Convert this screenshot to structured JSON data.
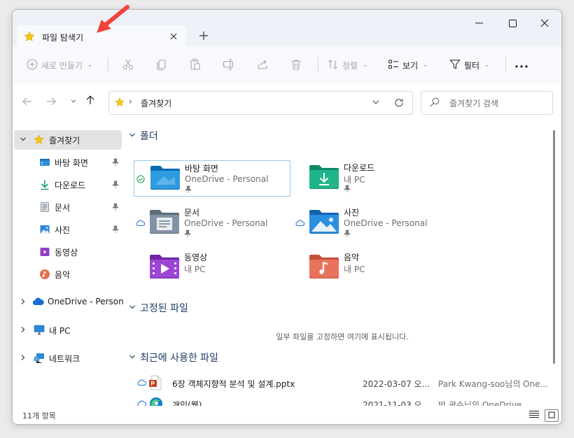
{
  "window": {
    "tab_title": "파일 탐색기"
  },
  "toolbar": {
    "new_label": "새로 만들기",
    "sort_label": "정렬",
    "view_label": "보기",
    "filter_label": "필터"
  },
  "address": {
    "location": "즐겨찾기",
    "separator": "›"
  },
  "search": {
    "placeholder": "즐겨찾기 검색"
  },
  "sidebar": {
    "favorites": "즐겨찾기",
    "items": [
      {
        "label": "바탕 화면"
      },
      {
        "label": "다운로드"
      },
      {
        "label": "문서"
      },
      {
        "label": "사진"
      },
      {
        "label": "동영상"
      },
      {
        "label": "음악"
      }
    ],
    "onedrive": "OneDrive - Persona",
    "thispc": "내 PC",
    "network": "네트워크"
  },
  "sections": {
    "folders": "폴더",
    "pinned": "고정된 파일",
    "recent": "최근에 사용한 파일",
    "pinned_empty": "일부 파일을 고정하면 여기에 표시됩니다."
  },
  "quick_access": [
    {
      "name": "바탕 화면",
      "location": "OneDrive - Personal"
    },
    {
      "name": "다운로드",
      "location": "내 PC"
    },
    {
      "name": "문서",
      "location": "OneDrive - Personal"
    },
    {
      "name": "사진",
      "location": "OneDrive - Personal"
    },
    {
      "name": "동영상",
      "location": "내 PC"
    },
    {
      "name": "음악",
      "location": "내 PC"
    }
  ],
  "recent_files": [
    {
      "name": "6장 객체지향적 분석 및 설계.pptx",
      "date": "2022-03-07 오...",
      "location": "Park Kwang-soo님의 One..."
    },
    {
      "name": "개인(웹)",
      "date": "2021-11-03 오...",
      "location": "박 광수님의 OneDrive"
    }
  ],
  "status": {
    "item_count": "11개 항목"
  },
  "colors": {
    "accent": "#0067c0",
    "annotation_arrow": "#f0443a",
    "favorite_star": "#f5c518"
  }
}
